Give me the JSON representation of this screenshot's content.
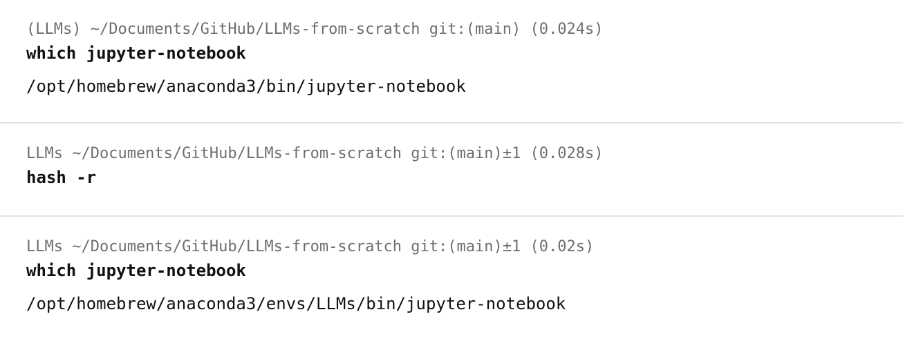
{
  "blocks": [
    {
      "prompt": "(LLMs) ~/Documents/GitHub/LLMs-from-scratch git:(main) (0.024s)",
      "command": "which jupyter-notebook",
      "output": "/opt/homebrew/anaconda3/bin/jupyter-notebook"
    },
    {
      "prompt": "LLMs ~/Documents/GitHub/LLMs-from-scratch git:(main)±1 (0.028s)",
      "command": "hash -r",
      "output": ""
    },
    {
      "prompt": "LLMs ~/Documents/GitHub/LLMs-from-scratch git:(main)±1 (0.02s)",
      "command": "which jupyter-notebook",
      "output": "/opt/homebrew/anaconda3/envs/LLMs/bin/jupyter-notebook"
    }
  ]
}
